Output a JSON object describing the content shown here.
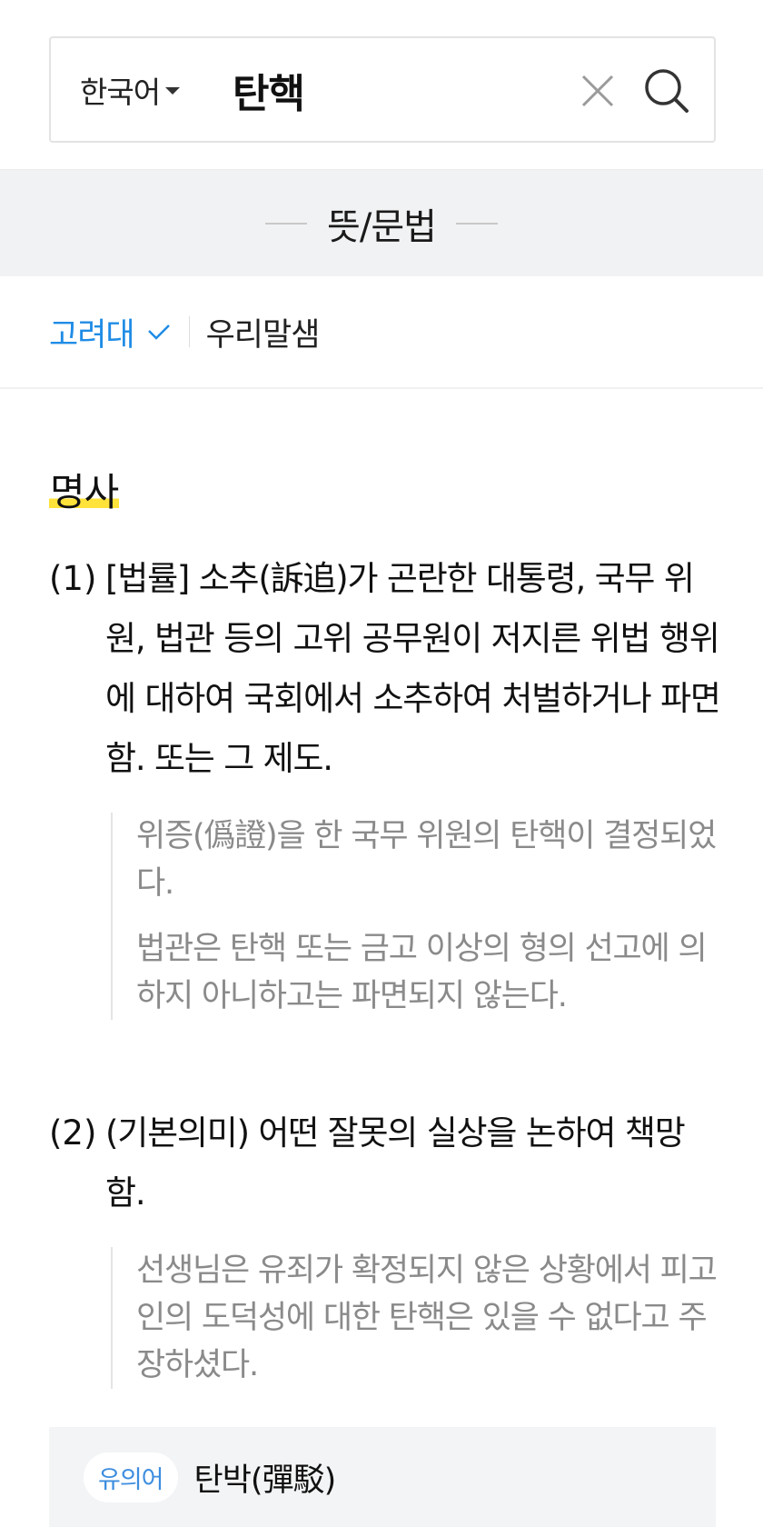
{
  "search": {
    "language": "한국어",
    "query": "탄핵"
  },
  "section": {
    "title": "뜻/문법"
  },
  "dictionaries": [
    {
      "label": "고려대",
      "active": true
    },
    {
      "label": "우리말샘",
      "active": false
    }
  ],
  "entry": {
    "part_of_speech": "명사",
    "senses": [
      {
        "number": "(1)",
        "definition": "[법률] 소추(訴追)가 곤란한 대통령, 국무 위원, 법관 등의 고위 공무원이 저지른 위법 행위에 대하여 국회에서 소추하여 처벌하거나 파면함. 또는 그 제도.",
        "examples": [
          "위증(僞證)을 한 국무 위원의 탄핵이 결정되었다.",
          "법관은 탄핵 또는 금고 이상의 형의 선고에 의하지 아니하고는 파면되지 않는다."
        ]
      },
      {
        "number": "(2)",
        "definition": "(기본의미) 어떤 잘못의 실상을 논하여 책망함.",
        "examples": [
          "선생님은 유죄가 확정되지 않은 상황에서 피고인의 도덕성에 대한 탄핵은 있을 수 없다고 주장하셨다."
        ]
      }
    ],
    "synonym": {
      "badge": "유의어",
      "word": "탄박(彈駁)"
    }
  },
  "colors": {
    "accent": "#1f8ce6",
    "highlight": "#ffe23a",
    "example_text": "#8a8a8a",
    "header_bg": "#f1f2f3"
  }
}
